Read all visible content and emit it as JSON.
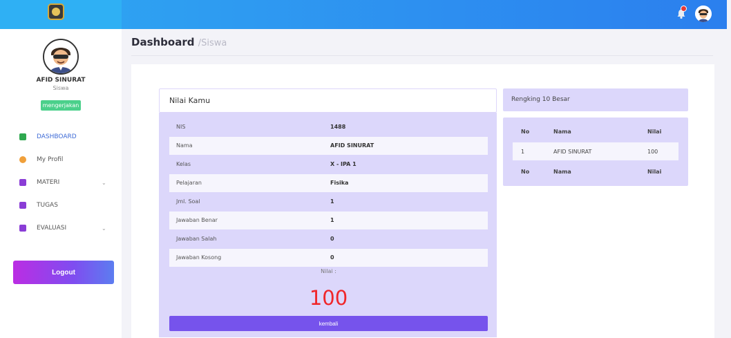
{
  "header": {
    "notification_count": "0"
  },
  "sidebar": {
    "user_name": "AFID SINURAT",
    "user_role": "Siswa",
    "status": "mengerjakan",
    "items": [
      {
        "label": "DASHBOARD",
        "icon": "dashboard-icon",
        "color": "#2fa84f",
        "has_caret": false
      },
      {
        "label": "My Profil",
        "icon": "user-icon",
        "color": "#f0a03a",
        "has_caret": false
      },
      {
        "label": "MATERI",
        "icon": "document-icon",
        "color": "#8a3dd6",
        "has_caret": true
      },
      {
        "label": "TUGAS",
        "icon": "document-icon",
        "color": "#8a3dd6",
        "has_caret": false
      },
      {
        "label": "EVALUASI",
        "icon": "document-icon",
        "color": "#8a3dd6",
        "has_caret": true
      }
    ],
    "logout_label": "Logout"
  },
  "page": {
    "title": "Dashboard",
    "subtitle": "/Siswa"
  },
  "nilai_kamu": {
    "title": "Nilai Kamu",
    "rows": [
      {
        "label": "NIS",
        "value": "1488"
      },
      {
        "label": "Nama",
        "value": "AFID SINURAT"
      },
      {
        "label": "Kelas",
        "value": "X - IPA 1"
      },
      {
        "label": "Pelajaran",
        "value": "Fisika"
      },
      {
        "label": "Jml. Soal",
        "value": "1"
      },
      {
        "label": "Jawaban Benar",
        "value": "1"
      },
      {
        "label": "Jawaban Salah",
        "value": "0"
      },
      {
        "label": "Jawaban Kosong",
        "value": "0"
      }
    ],
    "nilai_label": "Nilai :",
    "nilai_value": "100",
    "back_label": "kembali"
  },
  "rengking": {
    "title": "Rengking 10 Besar",
    "columns": [
      "No",
      "Nama",
      "Nilai"
    ],
    "rows": [
      [
        "1",
        "AFID SINURAT",
        "100"
      ]
    ],
    "footer": [
      "No",
      "Nama",
      "Nilai"
    ]
  },
  "colors": {
    "topbar": "#2d8ff0",
    "accent": "#7653ec",
    "panel": "#dcd7fb",
    "score": "#f0262a",
    "status_badge": "#4bd08b"
  }
}
